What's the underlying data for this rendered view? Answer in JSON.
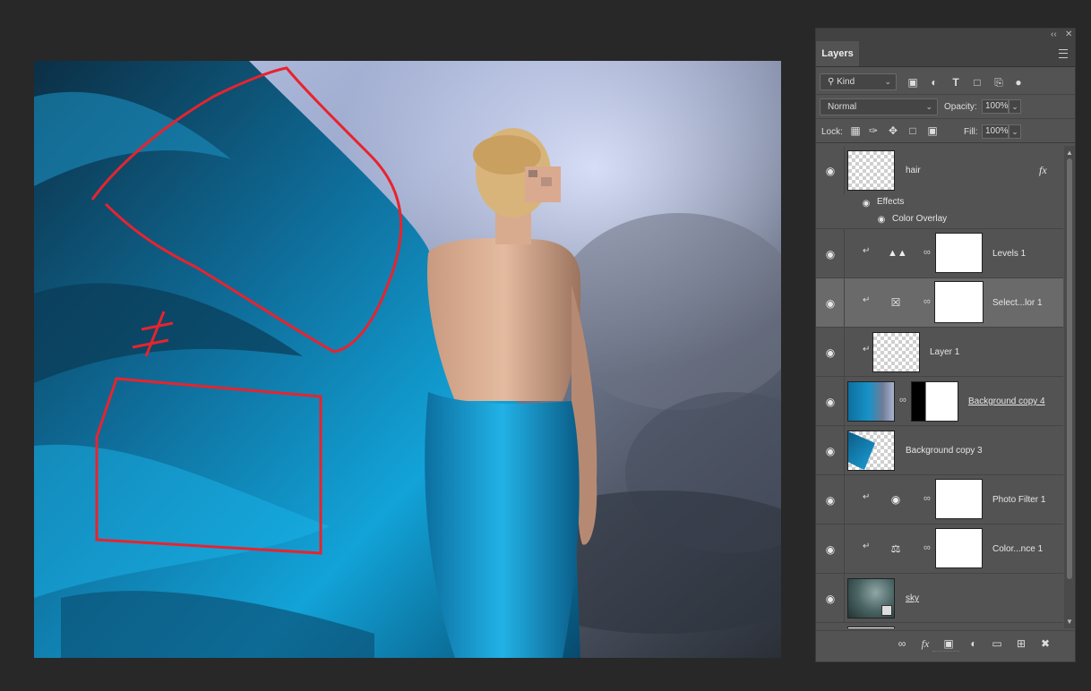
{
  "panel": {
    "tab_label": "Layers",
    "collapse_glyph": "‹‹",
    "close_glyph": "✕",
    "filter": {
      "kind_label": "Kind",
      "icons": [
        "image-filter-icon",
        "adjustment-filter-icon",
        "type-filter-icon",
        "shape-filter-icon",
        "smart-object-filter-icon",
        "toggle-filter-icon"
      ]
    },
    "blend_mode": "Normal",
    "opacity_label": "Opacity:",
    "opacity_value": "100%",
    "lock_label": "Lock:",
    "fill_label": "Fill:",
    "fill_value": "100%"
  },
  "layers": [
    {
      "name": "hair",
      "fx": "fx",
      "effects_label": "Effects",
      "effect": "Color Overlay"
    },
    {
      "name": "Levels 1"
    },
    {
      "name": "Select...lor 1",
      "selected": true
    },
    {
      "name": "Layer 1"
    },
    {
      "name": "Background copy 4"
    },
    {
      "name": "Background copy 3"
    },
    {
      "name": "Photo Filter 1"
    },
    {
      "name": "Color...nce 1"
    },
    {
      "name": "sky"
    }
  ],
  "bottom_icons": [
    "link-layers-icon",
    "fx-icon",
    "add-mask-icon",
    "new-adjustment-icon",
    "new-group-icon",
    "new-layer-icon",
    "delete-layer-icon"
  ],
  "annotation": {
    "not_equal_symbol": "≠",
    "color": "#e8232e"
  },
  "colors": {
    "panel_bg": "#535353",
    "app_bg": "#282828",
    "selected_row": "#6a6a6a"
  }
}
